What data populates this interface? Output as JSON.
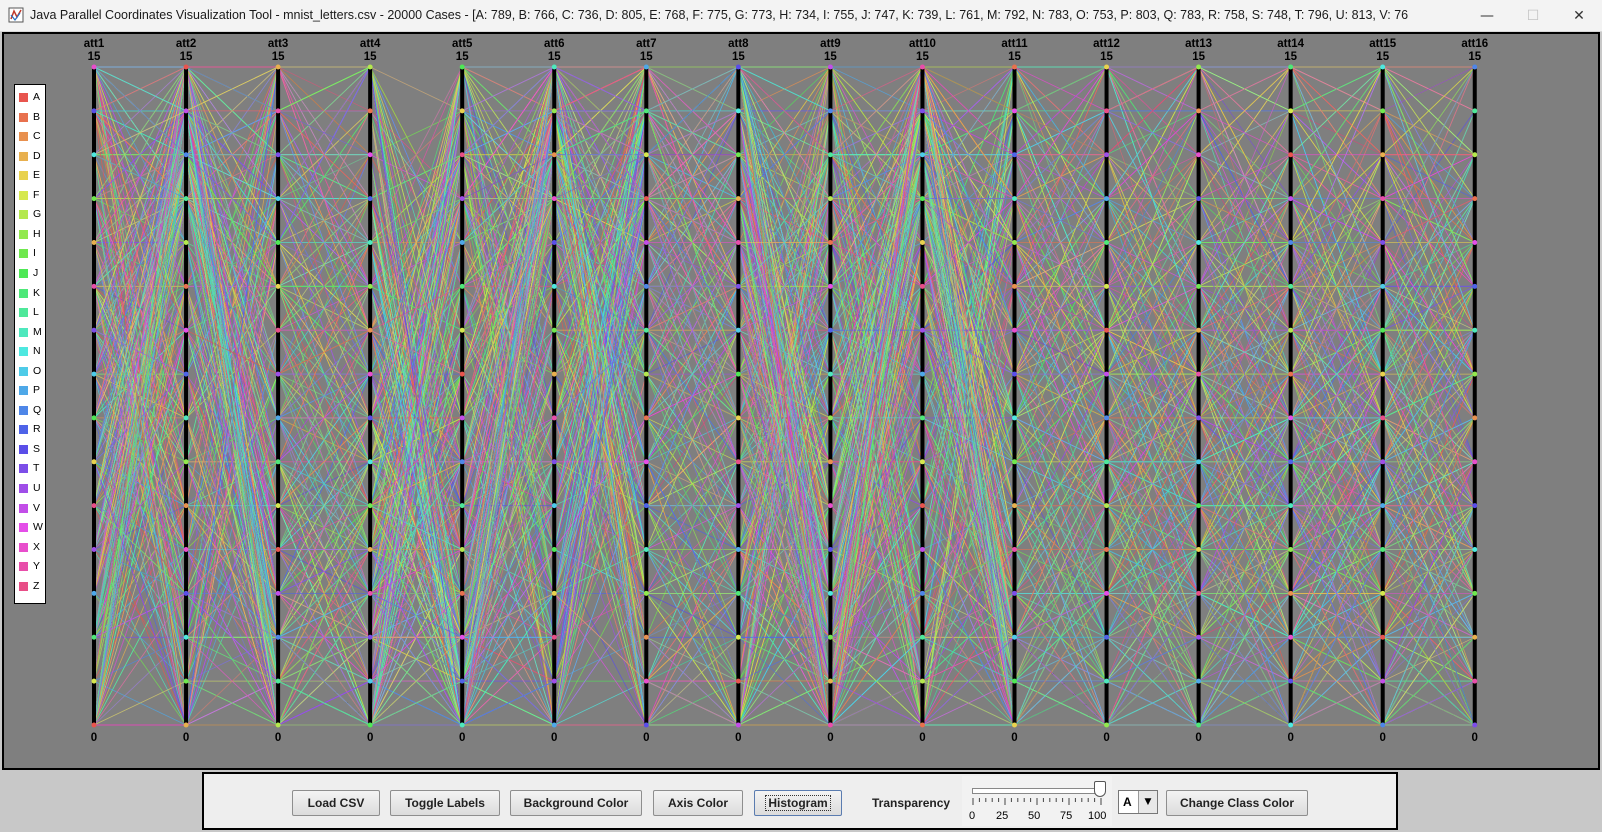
{
  "window": {
    "title": "Java Parallel Coordinates Visualization Tool - mnist_letters.csv - 20000 Cases - [A: 789, B: 766, C: 736, D: 805, E: 768, F: 775, G: 773, H: 734, I: 755, J: 747, K: 739, L: 761, M: 792, N: 783, O: 753, P: 803, Q: 783, R: 758, S: 748, T: 796, U: 813, V: 76",
    "minimize_glyph": "—",
    "maximize_glyph": "☐",
    "close_glyph": "✕"
  },
  "plot": {
    "background_color": "#7f7f7f",
    "axis_color": "#000000",
    "axis_max_label": "15",
    "axis_min_label": "0",
    "axes": [
      "att1",
      "att2",
      "att3",
      "att4",
      "att5",
      "att6",
      "att7",
      "att8",
      "att9",
      "att10",
      "att11",
      "att12",
      "att13",
      "att14",
      "att15",
      "att16"
    ]
  },
  "legend": {
    "classes": [
      {
        "label": "A",
        "color": "#e8554e"
      },
      {
        "label": "B",
        "color": "#e8714e"
      },
      {
        "label": "C",
        "color": "#e8904e"
      },
      {
        "label": "D",
        "color": "#e8b04e"
      },
      {
        "label": "E",
        "color": "#e8d24e"
      },
      {
        "label": "F",
        "color": "#d6e84e"
      },
      {
        "label": "G",
        "color": "#b4e84e"
      },
      {
        "label": "H",
        "color": "#92e84e"
      },
      {
        "label": "I",
        "color": "#6fe84e"
      },
      {
        "label": "J",
        "color": "#4ee855"
      },
      {
        "label": "K",
        "color": "#4ee878"
      },
      {
        "label": "L",
        "color": "#4ee89a"
      },
      {
        "label": "M",
        "color": "#4ee8bd"
      },
      {
        "label": "N",
        "color": "#4ee8e0"
      },
      {
        "label": "O",
        "color": "#4ecbe8"
      },
      {
        "label": "P",
        "color": "#4ea8e8"
      },
      {
        "label": "Q",
        "color": "#4e86e8"
      },
      {
        "label": "R",
        "color": "#4e63e8"
      },
      {
        "label": "S",
        "color": "#5a4ee8"
      },
      {
        "label": "T",
        "color": "#7c4ee8"
      },
      {
        "label": "U",
        "color": "#9f4ee8"
      },
      {
        "label": "V",
        "color": "#c24ee8"
      },
      {
        "label": "W",
        "color": "#e44ee8"
      },
      {
        "label": "X",
        "color": "#e84ecc"
      },
      {
        "label": "Y",
        "color": "#e84eaa"
      },
      {
        "label": "Z",
        "color": "#e84e87"
      }
    ]
  },
  "toolbar": {
    "load_csv": "Load CSV",
    "toggle_labels": "Toggle Labels",
    "background_color": "Background Color",
    "axis_color": "Axis Color",
    "histogram": "Histogram",
    "transparency_label": "Transparency",
    "transparency_value": 100,
    "slider_ticks": [
      "0",
      "25",
      "50",
      "75",
      "100"
    ],
    "selected_class": "A",
    "change_class_color": "Change Class Color"
  }
}
